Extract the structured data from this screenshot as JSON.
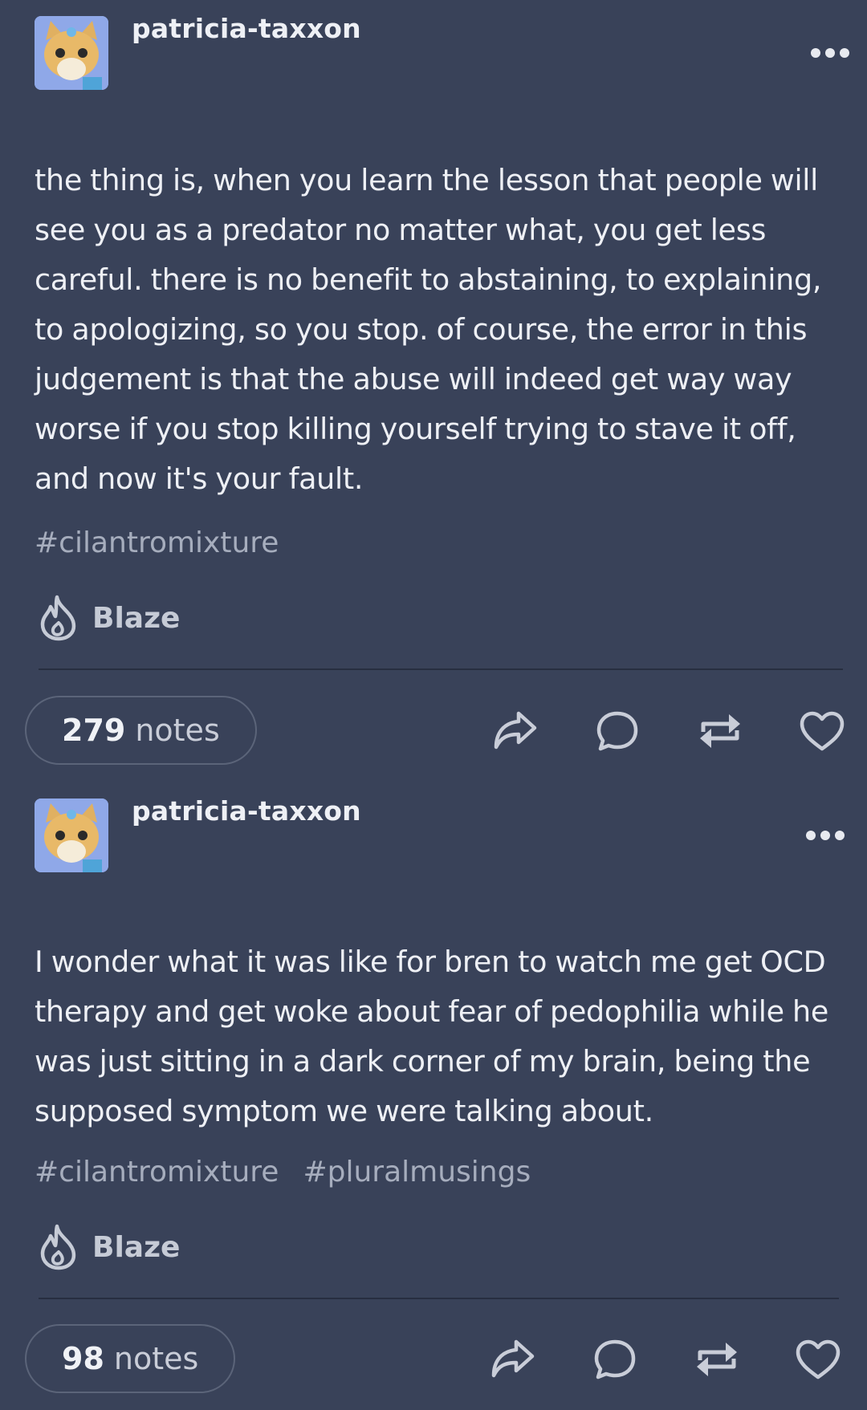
{
  "posts": [
    {
      "username": "patricia-taxxon",
      "body": "the thing is, when you learn the lesson that people will see you as a predator no matter what, you get less careful. there is no benefit to abstaining, to explaining, to apologizing, so you stop. of course, the error in this judgement is that the abuse will indeed get way way worse if you stop killing yourself trying to stave it off, and now it's your fault.",
      "tags": [
        "#cilantromixture"
      ],
      "blaze_label": "Blaze",
      "notes_count": "279",
      "notes_label": "notes"
    },
    {
      "username": "patricia-taxxon",
      "body": "I wonder what it was like for bren to watch me get OCD therapy and get woke about fear of pedophilia while he was just sitting in a dark corner of my brain, being the supposed symptom we were talking about.",
      "tags": [
        "#cilantromixture",
        "#pluralmusings"
      ],
      "blaze_label": "Blaze",
      "notes_count": "98",
      "notes_label": "notes"
    }
  ],
  "colors": {
    "background": "#394259",
    "text": "#eef0f5",
    "tag": "#a6adbd",
    "divider": "#272e40"
  },
  "icons": [
    "avatar",
    "more-icon",
    "flame-icon",
    "share-icon",
    "comment-icon",
    "reblog-icon",
    "heart-icon"
  ]
}
